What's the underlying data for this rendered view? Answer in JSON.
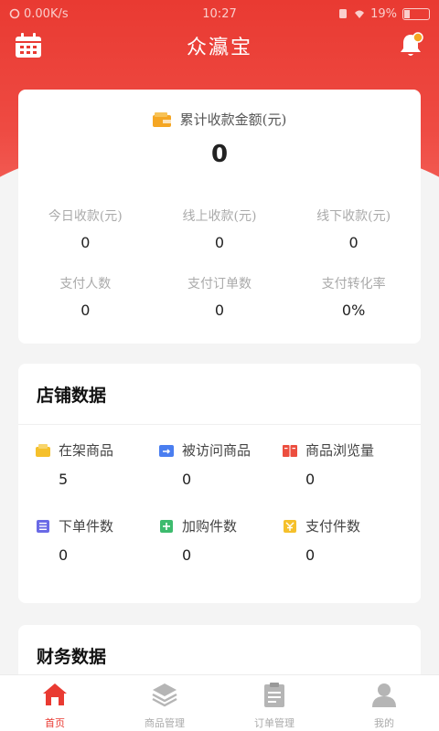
{
  "status_bar": {
    "left": "0.00K/s",
    "time": "10:27",
    "battery": "19%"
  },
  "header": {
    "title": "众瀛宝"
  },
  "summary": {
    "total_label": "累计收款金额(元)",
    "total_value": "0",
    "stats_row1": [
      {
        "label": "今日收款(元)",
        "value": "0"
      },
      {
        "label": "线上收款(元)",
        "value": "0"
      },
      {
        "label": "线下收款(元)",
        "value": "0"
      }
    ],
    "stats_row2": [
      {
        "label": "支付人数",
        "value": "0"
      },
      {
        "label": "支付订单数",
        "value": "0"
      },
      {
        "label": "支付转化率",
        "value": "0%"
      }
    ]
  },
  "shop": {
    "title": "店铺数据",
    "row1": [
      {
        "label": "在架商品",
        "value": "5",
        "icon": "shelf-goods-icon",
        "color": "#f5c02b"
      },
      {
        "label": "被访问商品",
        "value": "0",
        "icon": "visited-goods-icon",
        "color": "#4a7ef0"
      },
      {
        "label": "商品浏览量",
        "value": "0",
        "icon": "book-views-icon",
        "color": "#ec4e3f"
      }
    ],
    "row2": [
      {
        "label": "下单件数",
        "value": "0",
        "icon": "order-list-icon",
        "color": "#6a6ae6"
      },
      {
        "label": "加购件数",
        "value": "0",
        "icon": "add-cart-icon",
        "color": "#3dbb6e"
      },
      {
        "label": "支付件数",
        "value": "0",
        "icon": "payment-icon",
        "color": "#f5c02b"
      }
    ]
  },
  "finance": {
    "title": "财务数据"
  },
  "tabs": [
    {
      "label": "首页",
      "icon": "home-icon",
      "active": true
    },
    {
      "label": "商品管理",
      "icon": "layers-icon",
      "active": false
    },
    {
      "label": "订单管理",
      "icon": "clipboard-icon",
      "active": false
    },
    {
      "label": "我的",
      "icon": "user-icon",
      "active": false
    }
  ],
  "colors": {
    "primary": "#e93a32",
    "badge": "#f5a623"
  }
}
